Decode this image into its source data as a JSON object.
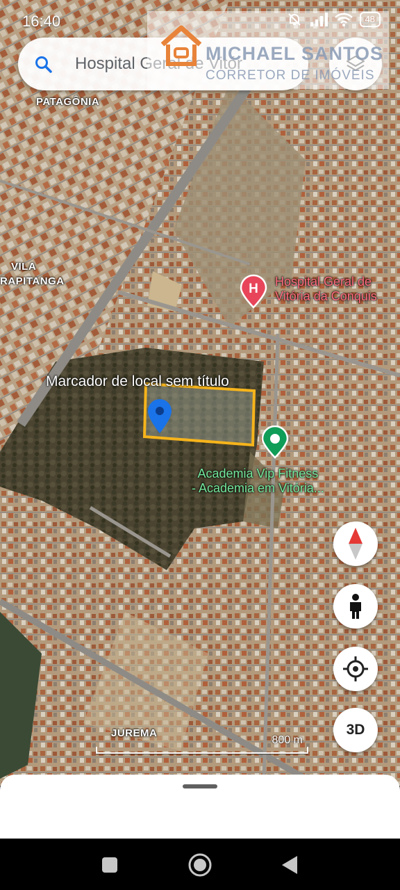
{
  "status_bar": {
    "time": "16:40",
    "battery": "48"
  },
  "watermark": {
    "line1": "MICHAEL SANTOS",
    "line2": "CORRETOR DE IMÓVEIS"
  },
  "search": {
    "query": "Hospital Geral de Vitór"
  },
  "map_labels": {
    "patagonia": "PATAGÔNIA",
    "vila": "VILA",
    "rapitanga": "RAPITANGA",
    "jurema": "JUREMA"
  },
  "places": {
    "hospital": {
      "line1": "Hospital Geral de",
      "line2": "Vitória da Conquis",
      "color": "#e8455a"
    },
    "gym": {
      "line1": "Academia Vip Fitness",
      "line2": "- Academia em Vitória...",
      "color": "#0f9d58"
    }
  },
  "marker": {
    "title": "Marcador de local sem título",
    "color": "#1a73e8"
  },
  "plot_outline_color": "#f6b41b",
  "controls": {
    "three_d_label": "3D"
  },
  "scale": {
    "label": "800 m"
  }
}
